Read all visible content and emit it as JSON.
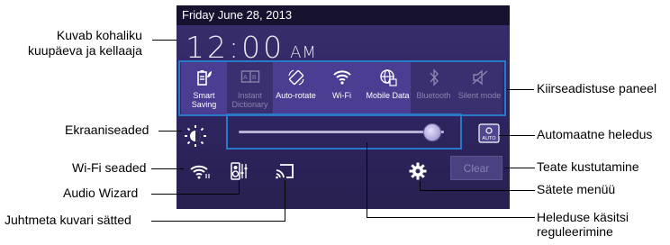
{
  "status": {
    "date": "Friday June 28, 2013",
    "time": "12:00",
    "ampm": "AM"
  },
  "quick_settings": [
    {
      "label": "Smart Saving",
      "icon": "smart-saving-icon",
      "on": true
    },
    {
      "label": "Instant Dictionary",
      "icon": "dictionary-icon",
      "on": false
    },
    {
      "label": "Auto-rotate",
      "icon": "rotate-icon",
      "on": true
    },
    {
      "label": "Wi-Fi",
      "icon": "wifi-icon",
      "on": true
    },
    {
      "label": "Mobile Data",
      "icon": "mobile-data-icon",
      "on": true
    },
    {
      "label": "Bluetooth",
      "icon": "bluetooth-icon",
      "on": false
    },
    {
      "label": "Silent mode",
      "icon": "silent-mode-icon",
      "on": false
    }
  ],
  "brightness": {
    "level": 0.94
  },
  "buttons": {
    "clear": "Clear"
  },
  "callouts": {
    "datetime": "Kuvab kohaliku\nkuupäeva ja kellaaja",
    "display": "Ekraaniseaded",
    "wifi": "Wi-Fi seaded",
    "audio": "Audio Wizard",
    "miracast": "Juhtmeta kuvari sätted",
    "quick_panel": "Kiirseadistuse paneel",
    "auto_brightness": "Automaatne heledus",
    "clear_notifications": "Teate kustutamine",
    "settings_menu": "Sätete menüü",
    "manual_brightness": "Heleduse käsitsi\nreguleerimine"
  },
  "colors": {
    "highlight": "#2a78c8",
    "panel": "#2e2560",
    "tile_on": "#4a3d92"
  }
}
